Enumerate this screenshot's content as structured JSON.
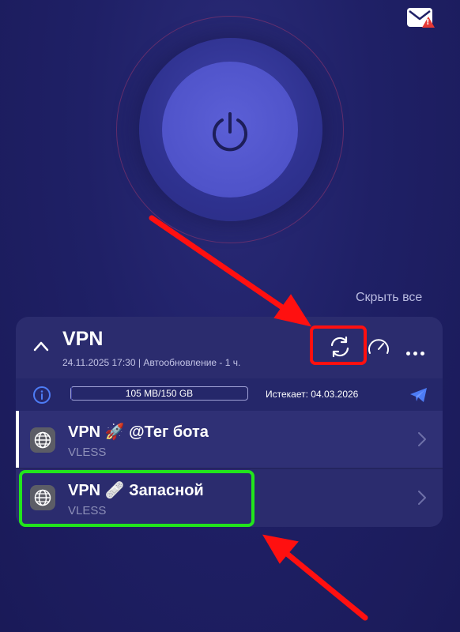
{
  "header": {
    "mail_icon": "mail-alert-icon"
  },
  "power": {
    "icon": "power-icon"
  },
  "hide_all_label": "Скрыть все",
  "subscription": {
    "title": "VPN",
    "meta": "24.11.2025 17:30 | Автообновление - 1 ч.",
    "traffic_text": "105 MB/150 GB",
    "traffic_used_fraction": 0.0007,
    "expires_text": "Истекает: 04.03.2026",
    "icons": {
      "collapse": "chevron-up-icon",
      "refresh": "refresh-icon",
      "speedtest": "speedometer-icon",
      "more": "more-dots-icon",
      "info": "info-icon",
      "telegram": "telegram-icon"
    }
  },
  "servers": [
    {
      "title": "VPN 🚀 @Тег бота",
      "protocol": "VLESS",
      "active": true
    },
    {
      "title": "VPN 🩹 Запасной",
      "protocol": "VLESS",
      "active": false
    }
  ],
  "colors": {
    "background": "#1f2066",
    "card": "#2b2c6e",
    "highlight_red": "#ff1010",
    "highlight_green": "#22e51c",
    "telegram_blue": "#4d7cf5"
  }
}
